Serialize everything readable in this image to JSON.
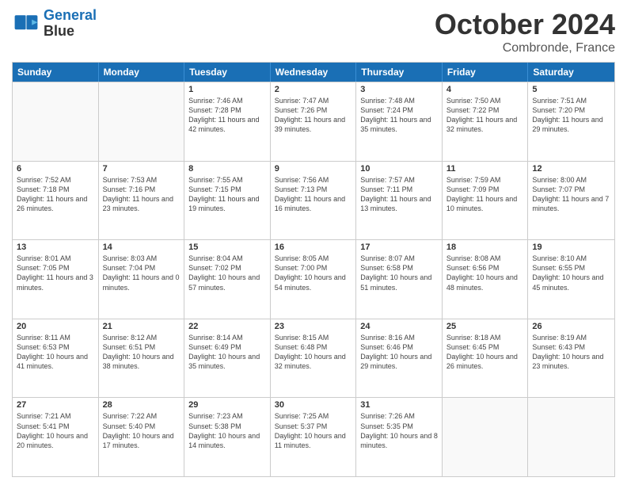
{
  "header": {
    "logo_line1": "General",
    "logo_line2": "Blue",
    "main_title": "October 2024",
    "subtitle": "Combronde, France"
  },
  "days_of_week": [
    "Sunday",
    "Monday",
    "Tuesday",
    "Wednesday",
    "Thursday",
    "Friday",
    "Saturday"
  ],
  "weeks": [
    [
      {
        "day": "",
        "sunrise": "",
        "sunset": "",
        "daylight": ""
      },
      {
        "day": "",
        "sunrise": "",
        "sunset": "",
        "daylight": ""
      },
      {
        "day": "1",
        "sunrise": "Sunrise: 7:46 AM",
        "sunset": "Sunset: 7:28 PM",
        "daylight": "Daylight: 11 hours and 42 minutes."
      },
      {
        "day": "2",
        "sunrise": "Sunrise: 7:47 AM",
        "sunset": "Sunset: 7:26 PM",
        "daylight": "Daylight: 11 hours and 39 minutes."
      },
      {
        "day": "3",
        "sunrise": "Sunrise: 7:48 AM",
        "sunset": "Sunset: 7:24 PM",
        "daylight": "Daylight: 11 hours and 35 minutes."
      },
      {
        "day": "4",
        "sunrise": "Sunrise: 7:50 AM",
        "sunset": "Sunset: 7:22 PM",
        "daylight": "Daylight: 11 hours and 32 minutes."
      },
      {
        "day": "5",
        "sunrise": "Sunrise: 7:51 AM",
        "sunset": "Sunset: 7:20 PM",
        "daylight": "Daylight: 11 hours and 29 minutes."
      }
    ],
    [
      {
        "day": "6",
        "sunrise": "Sunrise: 7:52 AM",
        "sunset": "Sunset: 7:18 PM",
        "daylight": "Daylight: 11 hours and 26 minutes."
      },
      {
        "day": "7",
        "sunrise": "Sunrise: 7:53 AM",
        "sunset": "Sunset: 7:16 PM",
        "daylight": "Daylight: 11 hours and 23 minutes."
      },
      {
        "day": "8",
        "sunrise": "Sunrise: 7:55 AM",
        "sunset": "Sunset: 7:15 PM",
        "daylight": "Daylight: 11 hours and 19 minutes."
      },
      {
        "day": "9",
        "sunrise": "Sunrise: 7:56 AM",
        "sunset": "Sunset: 7:13 PM",
        "daylight": "Daylight: 11 hours and 16 minutes."
      },
      {
        "day": "10",
        "sunrise": "Sunrise: 7:57 AM",
        "sunset": "Sunset: 7:11 PM",
        "daylight": "Daylight: 11 hours and 13 minutes."
      },
      {
        "day": "11",
        "sunrise": "Sunrise: 7:59 AM",
        "sunset": "Sunset: 7:09 PM",
        "daylight": "Daylight: 11 hours and 10 minutes."
      },
      {
        "day": "12",
        "sunrise": "Sunrise: 8:00 AM",
        "sunset": "Sunset: 7:07 PM",
        "daylight": "Daylight: 11 hours and 7 minutes."
      }
    ],
    [
      {
        "day": "13",
        "sunrise": "Sunrise: 8:01 AM",
        "sunset": "Sunset: 7:05 PM",
        "daylight": "Daylight: 11 hours and 3 minutes."
      },
      {
        "day": "14",
        "sunrise": "Sunrise: 8:03 AM",
        "sunset": "Sunset: 7:04 PM",
        "daylight": "Daylight: 11 hours and 0 minutes."
      },
      {
        "day": "15",
        "sunrise": "Sunrise: 8:04 AM",
        "sunset": "Sunset: 7:02 PM",
        "daylight": "Daylight: 10 hours and 57 minutes."
      },
      {
        "day": "16",
        "sunrise": "Sunrise: 8:05 AM",
        "sunset": "Sunset: 7:00 PM",
        "daylight": "Daylight: 10 hours and 54 minutes."
      },
      {
        "day": "17",
        "sunrise": "Sunrise: 8:07 AM",
        "sunset": "Sunset: 6:58 PM",
        "daylight": "Daylight: 10 hours and 51 minutes."
      },
      {
        "day": "18",
        "sunrise": "Sunrise: 8:08 AM",
        "sunset": "Sunset: 6:56 PM",
        "daylight": "Daylight: 10 hours and 48 minutes."
      },
      {
        "day": "19",
        "sunrise": "Sunrise: 8:10 AM",
        "sunset": "Sunset: 6:55 PM",
        "daylight": "Daylight: 10 hours and 45 minutes."
      }
    ],
    [
      {
        "day": "20",
        "sunrise": "Sunrise: 8:11 AM",
        "sunset": "Sunset: 6:53 PM",
        "daylight": "Daylight: 10 hours and 41 minutes."
      },
      {
        "day": "21",
        "sunrise": "Sunrise: 8:12 AM",
        "sunset": "Sunset: 6:51 PM",
        "daylight": "Daylight: 10 hours and 38 minutes."
      },
      {
        "day": "22",
        "sunrise": "Sunrise: 8:14 AM",
        "sunset": "Sunset: 6:49 PM",
        "daylight": "Daylight: 10 hours and 35 minutes."
      },
      {
        "day": "23",
        "sunrise": "Sunrise: 8:15 AM",
        "sunset": "Sunset: 6:48 PM",
        "daylight": "Daylight: 10 hours and 32 minutes."
      },
      {
        "day": "24",
        "sunrise": "Sunrise: 8:16 AM",
        "sunset": "Sunset: 6:46 PM",
        "daylight": "Daylight: 10 hours and 29 minutes."
      },
      {
        "day": "25",
        "sunrise": "Sunrise: 8:18 AM",
        "sunset": "Sunset: 6:45 PM",
        "daylight": "Daylight: 10 hours and 26 minutes."
      },
      {
        "day": "26",
        "sunrise": "Sunrise: 8:19 AM",
        "sunset": "Sunset: 6:43 PM",
        "daylight": "Daylight: 10 hours and 23 minutes."
      }
    ],
    [
      {
        "day": "27",
        "sunrise": "Sunrise: 7:21 AM",
        "sunset": "Sunset: 5:41 PM",
        "daylight": "Daylight: 10 hours and 20 minutes."
      },
      {
        "day": "28",
        "sunrise": "Sunrise: 7:22 AM",
        "sunset": "Sunset: 5:40 PM",
        "daylight": "Daylight: 10 hours and 17 minutes."
      },
      {
        "day": "29",
        "sunrise": "Sunrise: 7:23 AM",
        "sunset": "Sunset: 5:38 PM",
        "daylight": "Daylight: 10 hours and 14 minutes."
      },
      {
        "day": "30",
        "sunrise": "Sunrise: 7:25 AM",
        "sunset": "Sunset: 5:37 PM",
        "daylight": "Daylight: 10 hours and 11 minutes."
      },
      {
        "day": "31",
        "sunrise": "Sunrise: 7:26 AM",
        "sunset": "Sunset: 5:35 PM",
        "daylight": "Daylight: 10 hours and 8 minutes."
      },
      {
        "day": "",
        "sunrise": "",
        "sunset": "",
        "daylight": ""
      },
      {
        "day": "",
        "sunrise": "",
        "sunset": "",
        "daylight": ""
      }
    ]
  ]
}
